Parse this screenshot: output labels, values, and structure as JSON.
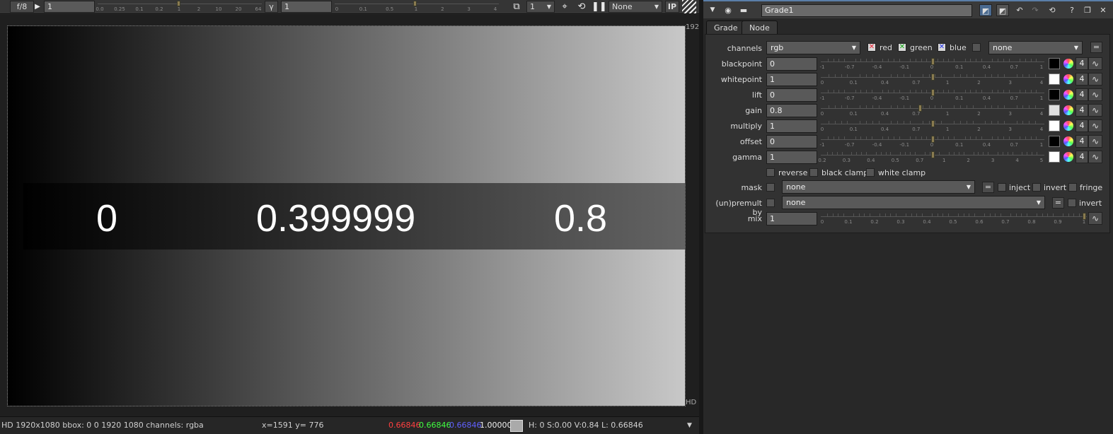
{
  "viewer": {
    "toolbar": {
      "fstop": "f/8",
      "gain_value": "1",
      "gain_ticks": [
        "0.0",
        "0.25",
        "0.1",
        "0.2",
        "1",
        "2",
        "10",
        "20",
        "64"
      ],
      "gamma_btn": "γ",
      "gamma_value": "1",
      "gamma_ticks": [
        "0",
        "0.1",
        "0.5",
        "1",
        "2",
        "3",
        "4"
      ],
      "frame_value": "1",
      "lut_value": "None",
      "ip_label": "IP"
    },
    "image": {
      "numbers": [
        "0",
        "0.399999",
        "0.8"
      ],
      "corner_top_right": "192",
      "corner_bottom_right": "HD"
    },
    "info": {
      "format": "HD 1920x1080 bbox: 0 0 1920 1080 channels: rgba",
      "coords": "x=1591 y= 776",
      "r": "0.66846",
      "g": "0.66846",
      "b": "0.66846",
      "a": "1.00000",
      "hsv": "H:  0 S:0.00 V:0.84  L: 0.66846",
      "colors": {
        "r": "#ff4040",
        "g": "#40ff40",
        "b": "#6060ff"
      }
    }
  },
  "properties": {
    "node_name": "Grade1",
    "tabs": [
      {
        "label": "Grade",
        "active": true
      },
      {
        "label": "Node",
        "active": false
      }
    ],
    "channels": {
      "label": "channels",
      "value": "rgb",
      "red": "red",
      "green": "green",
      "blue": "blue",
      "extra": "none",
      "eq": "="
    },
    "knobs": [
      {
        "label": "blackpoint",
        "value": "0",
        "swatch": "#000000",
        "pos": 0.5,
        "scale": "neg"
      },
      {
        "label": "whitepoint",
        "value": "1",
        "swatch": "#ffffff",
        "pos": 0.5,
        "scale": "pos"
      },
      {
        "label": "lift",
        "value": "0",
        "swatch": "#000000",
        "pos": 0.5,
        "scale": "neg"
      },
      {
        "label": "gain",
        "value": "0.8",
        "swatch": "#e0e0e0",
        "pos": 0.44,
        "scale": "pos"
      },
      {
        "label": "multiply",
        "value": "1",
        "swatch": "#ffffff",
        "pos": 0.5,
        "scale": "pos"
      },
      {
        "label": "offset",
        "value": "0",
        "swatch": "#000000",
        "pos": 0.5,
        "scale": "neg"
      },
      {
        "label": "gamma",
        "value": "1",
        "swatch": "#ffffff",
        "pos": 0.5,
        "scale": "gam"
      }
    ],
    "knob_four": "4",
    "scales": {
      "neg": [
        "-1",
        "-0.7",
        "-0.4",
        "-0.1",
        "0",
        "0.1",
        "0.4",
        "0.7",
        "1"
      ],
      "pos": [
        "0",
        "0.1",
        "0.4",
        "0.7",
        "1",
        "2",
        "3",
        "4"
      ],
      "gam": [
        "0.2",
        "0.3",
        "0.4",
        "0.5",
        "0.7",
        "1",
        "2",
        "3",
        "4",
        "5"
      ],
      "mix": [
        "0",
        "0.1",
        "0.2",
        "0.3",
        "0.4",
        "0.5",
        "0.6",
        "0.7",
        "0.8",
        "0.9",
        "1"
      ]
    },
    "options": {
      "reverse": "reverse",
      "black_clamp": "black clamp",
      "white_clamp": "white clamp"
    },
    "mask": {
      "label": "mask",
      "value": "none",
      "eq": "=",
      "inject": "inject",
      "invert": "invert",
      "fringe": "fringe"
    },
    "premult": {
      "label": "(un)premult by",
      "value": "none",
      "eq": "=",
      "invert": "invert"
    },
    "mix": {
      "label": "mix",
      "value": "1",
      "pos": 1.0
    }
  }
}
